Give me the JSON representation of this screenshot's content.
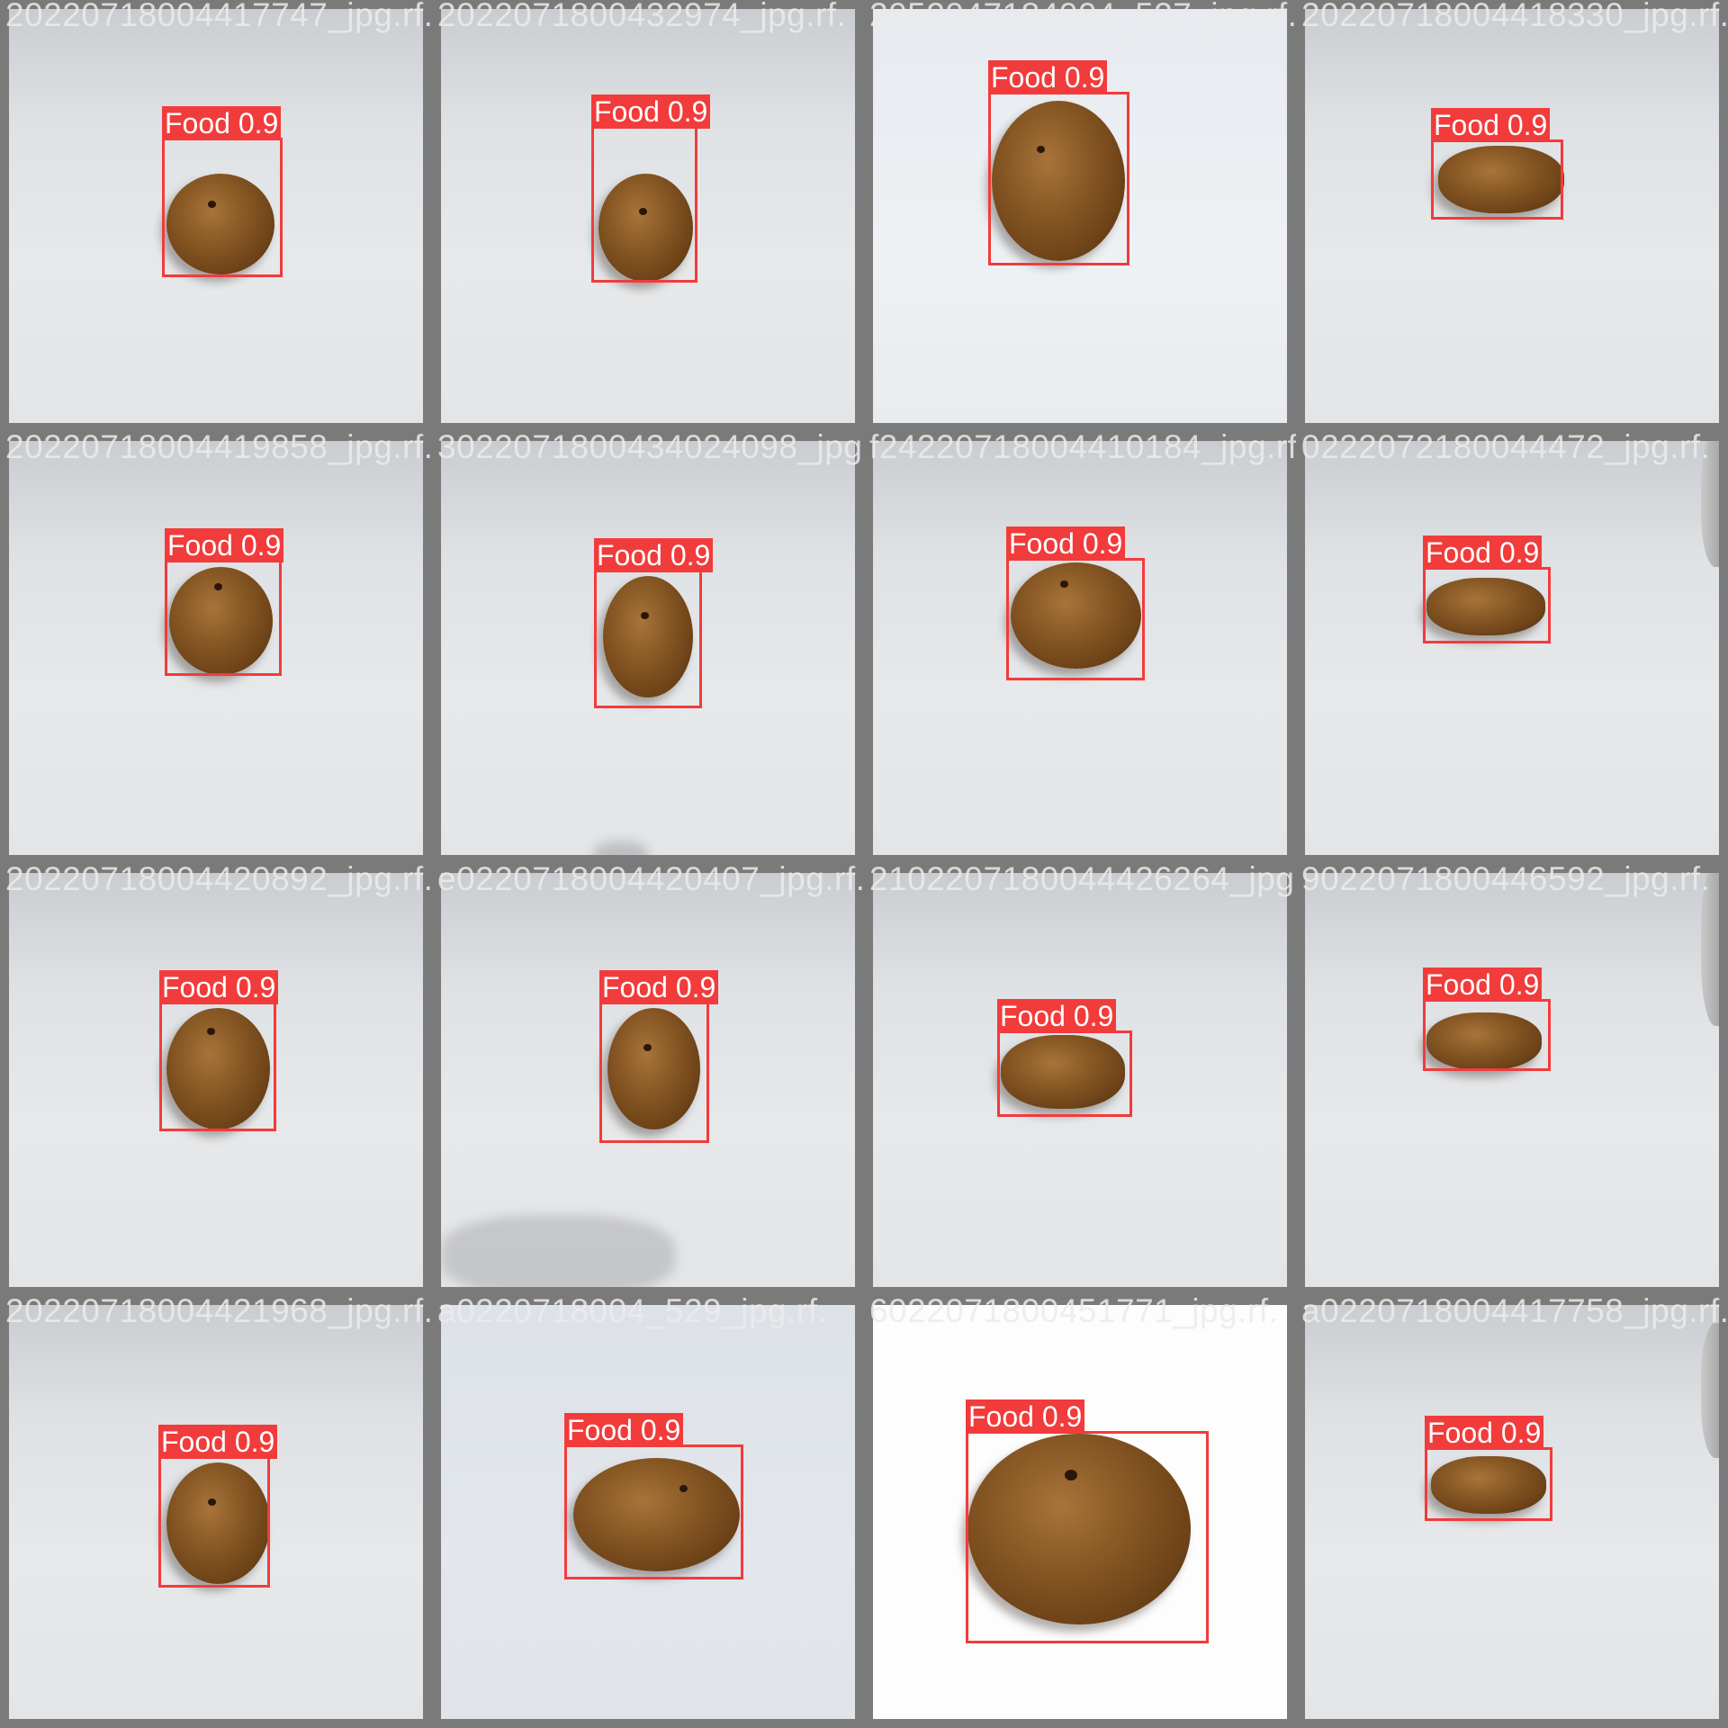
{
  "tiles": [
    {
      "filename": "20220718004417747_jpg.rf.a5421da886d5a22",
      "label": "Food 0.9"
    },
    {
      "filename": "2022071800432974_jpg.rf.",
      "label": "Food 0.9"
    },
    {
      "filename": "2052047184004_527_jpg.rf.",
      "label": "Food 0.9"
    },
    {
      "filename": "20220718004418330_jpg.rf.",
      "label": "Food 0.9"
    },
    {
      "filename": "20220718004419858_jpg.rf.",
      "label": "Food 0.9"
    },
    {
      "filename": "3022071800434024098_jpg.rf.",
      "label": "Food 0.9"
    },
    {
      "filename": "f24220718004410184_jpg.rf.",
      "label": "Food 0.9"
    },
    {
      "filename": "0222072180044472_jpg.rf.",
      "label": "Food 0.9"
    },
    {
      "filename": "20220718004420892_jpg.rf.",
      "label": "Food 0.9"
    },
    {
      "filename": "e0220718004420407_jpg.rf.",
      "label": "Food 0.9"
    },
    {
      "filename": "2102207180044426264_jpg.rf.",
      "label": "Food 0.9"
    },
    {
      "filename": "9022071800446592_jpg.rf.",
      "label": "Food 0.9"
    },
    {
      "filename": "20220718004421968_jpg.rf.",
      "label": "Food 0.9"
    },
    {
      "filename": "a0220718004_529_jpg.rf.",
      "label": "Food 0.9"
    },
    {
      "filename": "6022071800451771_jpg.rf.",
      "label": "Food 0.9"
    },
    {
      "filename": "a0220718004417758_jpg.rf.",
      "label": "Food 0.9"
    }
  ],
  "colors": {
    "box": "#f23b3b",
    "label_text": "#ffffff",
    "tile_border": "#7a7a7a"
  }
}
